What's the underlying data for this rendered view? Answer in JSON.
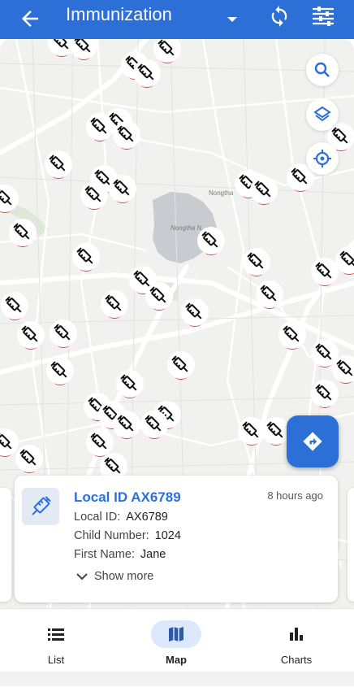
{
  "app_bar": {
    "title": "Immunization",
    "back_icon": "arrow-left-icon",
    "program_dropdown_icon": "caret-down-icon",
    "sync_icon": "sync-icon",
    "filter_icon": "filter-icon",
    "color": "#2c6fd6"
  },
  "map": {
    "labels": [
      "Nongtha",
      "Nongtha N..."
    ],
    "controls": [
      "search-icon",
      "layers-icon",
      "my-location-icon"
    ],
    "navigate_icon": "directions-icon",
    "marker_icon": "syringe-icon",
    "marker_accent": "#e53935"
  },
  "selected_event": {
    "title": "Local ID AX6789",
    "time_ago": "8 hours ago",
    "fields": [
      {
        "label": "Local ID:",
        "value": "AX6789"
      },
      {
        "label": "Child Number:",
        "value": "1024"
      },
      {
        "label": "First Name:",
        "value": "Jane"
      }
    ],
    "show_more_label": "Show more"
  },
  "bottom_nav": {
    "items": [
      {
        "label": "List",
        "icon": "list-icon",
        "active": false
      },
      {
        "label": "Map",
        "icon": "map-icon",
        "active": true
      },
      {
        "label": "Charts",
        "icon": "bar-chart-icon",
        "active": false
      }
    ]
  }
}
